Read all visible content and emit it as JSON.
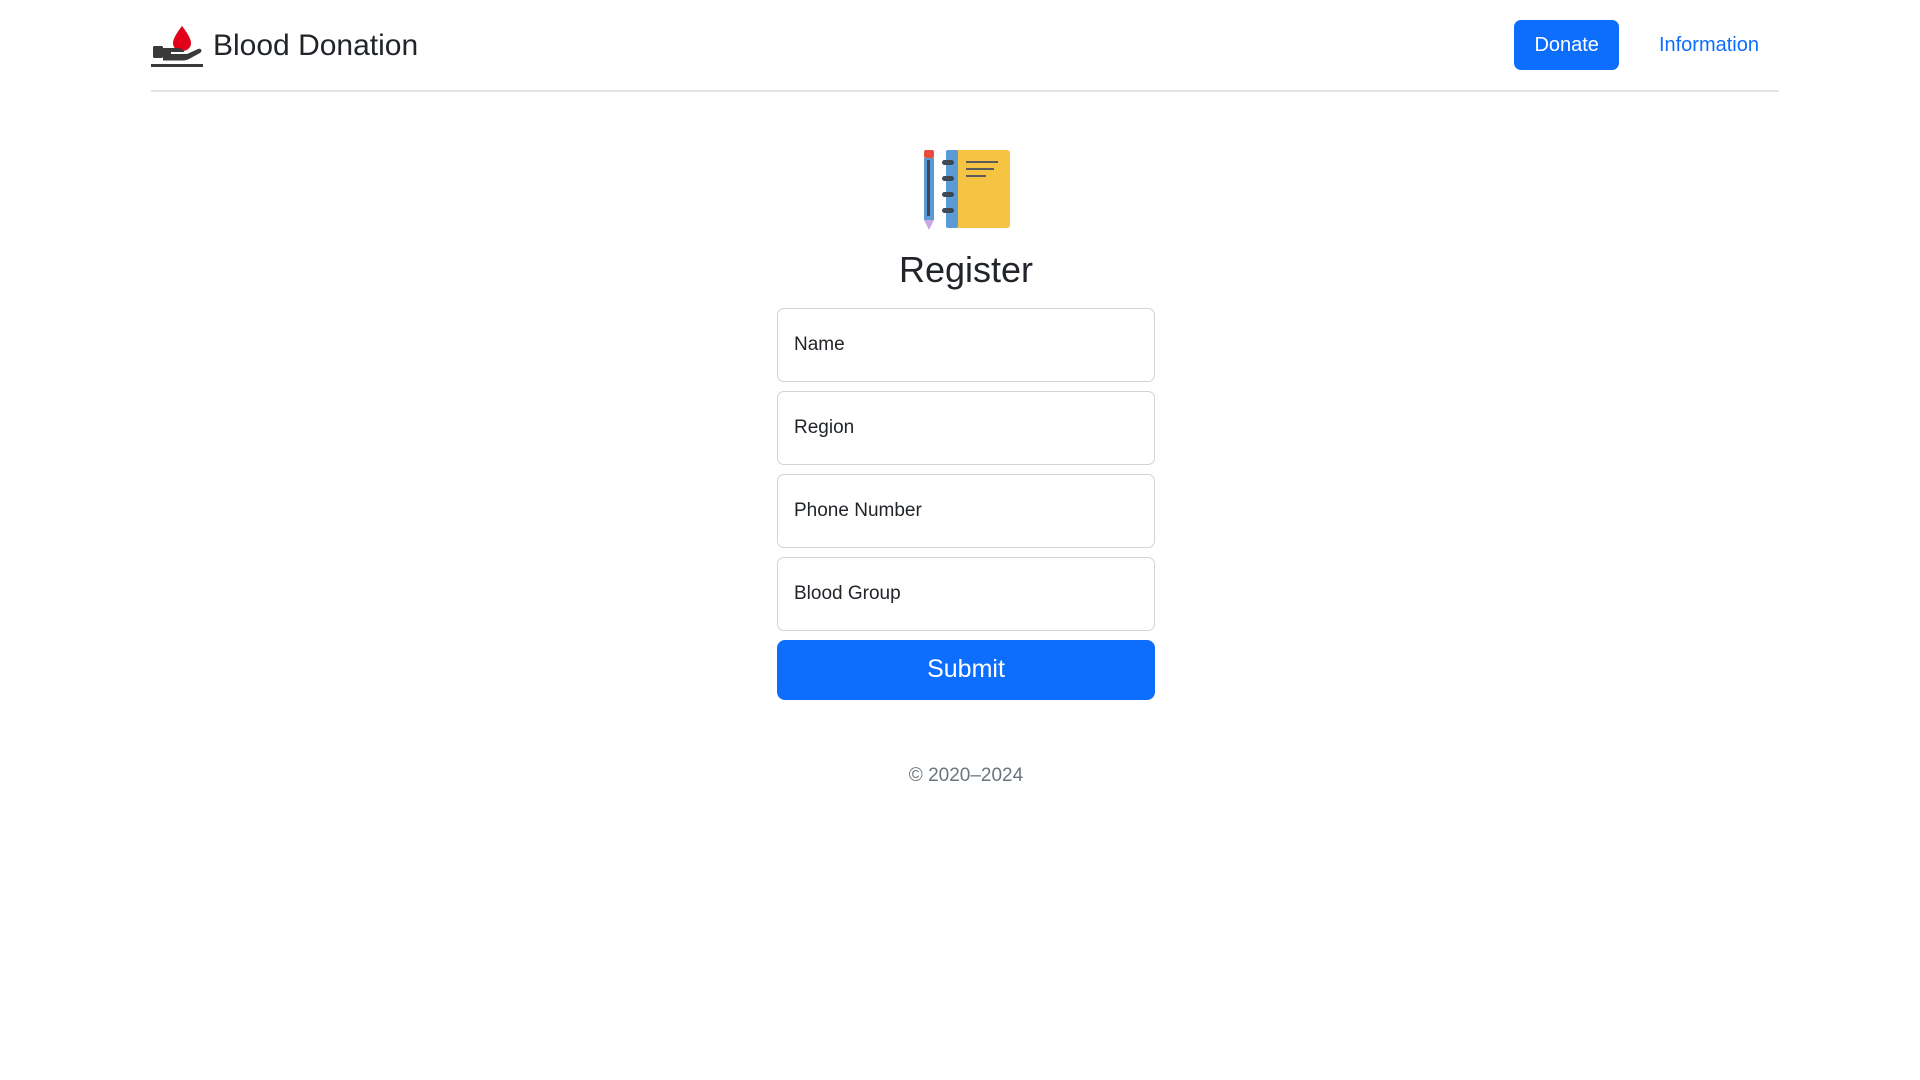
{
  "header": {
    "brand_title": "Blood Donation",
    "donate_label": "Donate",
    "information_label": "Information"
  },
  "main": {
    "title": "Register",
    "fields": {
      "name_placeholder": "Name",
      "region_placeholder": "Region",
      "phone_placeholder": "Phone Number",
      "blood_group_placeholder": "Blood Group"
    },
    "submit_label": "Submit"
  },
  "footer": {
    "copyright": "© 2020–2024"
  },
  "icons": {
    "brand": "blood-drop-hand-icon",
    "register": "notebook-pencil-icon"
  },
  "colors": {
    "primary": "#0d6efd",
    "blood_red": "#e3001b",
    "notebook_yellow": "#f6c343",
    "text_muted": "#6c757d"
  }
}
